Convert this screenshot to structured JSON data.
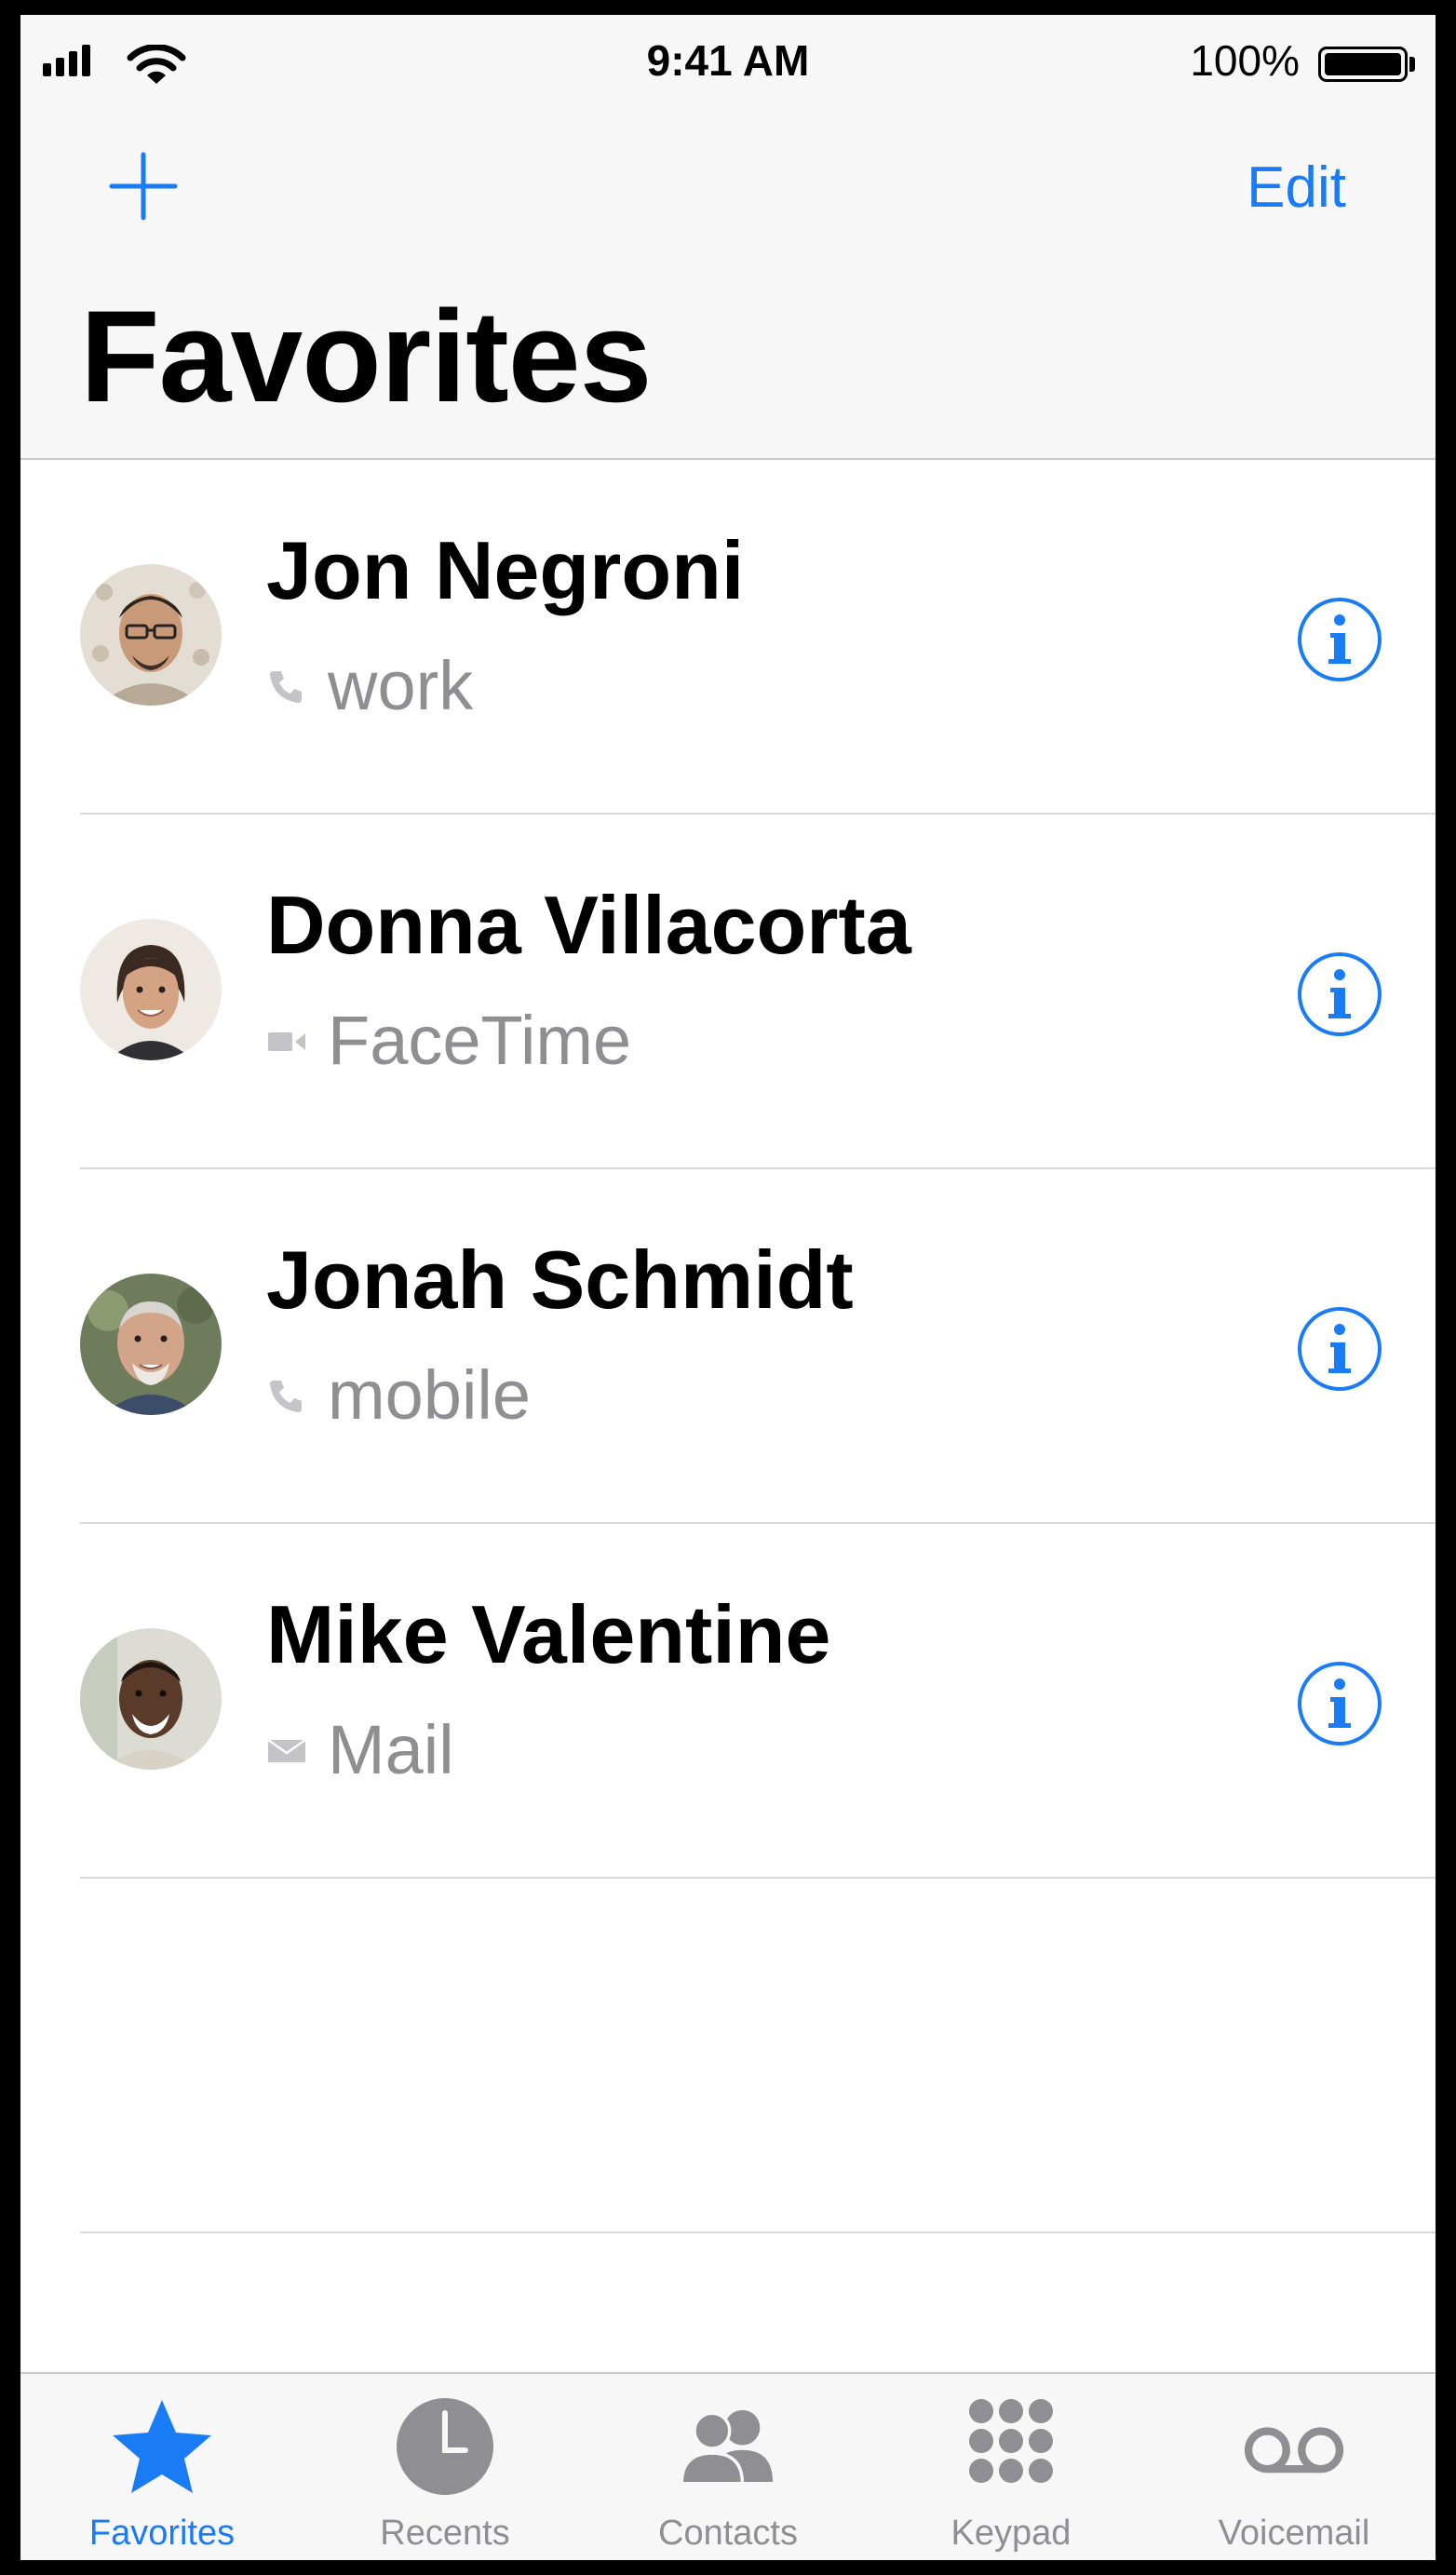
{
  "status_bar": {
    "time": "9:41 AM",
    "battery_percent": "100%",
    "battery_level": 1.0
  },
  "header": {
    "edit_label": "Edit",
    "title": "Favorites"
  },
  "colors": {
    "accent": "#1a7cf4",
    "secondary_text": "#8e8e93"
  },
  "contacts": [
    {
      "name": "Jon Negroni",
      "detail": "work",
      "detail_icon": "phone-icon"
    },
    {
      "name": "Donna Villacorta",
      "detail": "FaceTime",
      "detail_icon": "video-icon"
    },
    {
      "name": "Jonah Schmidt",
      "detail": "mobile",
      "detail_icon": "phone-icon"
    },
    {
      "name": "Mike Valentine",
      "detail": "Mail",
      "detail_icon": "mail-icon"
    }
  ],
  "tabs": [
    {
      "label": "Favorites",
      "icon": "star-icon",
      "active": true
    },
    {
      "label": "Recents",
      "icon": "clock-icon",
      "active": false
    },
    {
      "label": "Contacts",
      "icon": "contacts-icon",
      "active": false
    },
    {
      "label": "Keypad",
      "icon": "keypad-icon",
      "active": false
    },
    {
      "label": "Voicemail",
      "icon": "voicemail-icon",
      "active": false
    }
  ]
}
